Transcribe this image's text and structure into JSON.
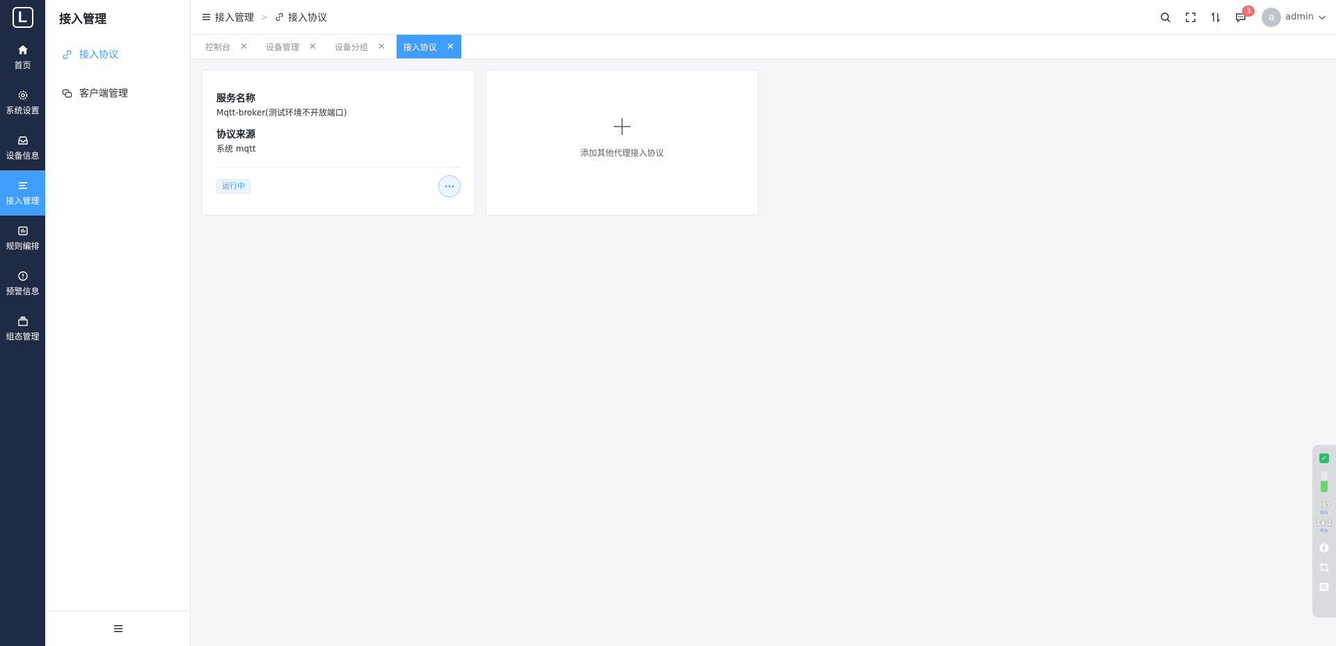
{
  "rail": {
    "logo": "L",
    "items": [
      {
        "label": "首页",
        "icon": "home-icon"
      },
      {
        "label": "系统设置",
        "icon": "gear-icon"
      },
      {
        "label": "设备信息",
        "icon": "inbox-icon"
      },
      {
        "label": "接入管理",
        "icon": "list-icon"
      },
      {
        "label": "规则编排",
        "icon": "chart-box-icon"
      },
      {
        "label": "预警信息",
        "icon": "alert-circle-icon"
      },
      {
        "label": "组态管理",
        "icon": "layers-icon"
      }
    ],
    "active_index": 3
  },
  "sidebar": {
    "title": "接入管理",
    "items": [
      {
        "label": "接入协议",
        "icon": "link-icon"
      },
      {
        "label": "客户端管理",
        "icon": "chat-icon"
      }
    ],
    "active_index": 0
  },
  "header": {
    "breadcrumb": [
      "接入管理",
      "接入协议"
    ],
    "badge_count": "3",
    "user_avatar": "a",
    "user_name": "admin"
  },
  "tabs": [
    {
      "label": "控制台"
    },
    {
      "label": "设备管理"
    },
    {
      "label": "设备分组"
    },
    {
      "label": "接入协议"
    }
  ],
  "active_tab": 3,
  "card": {
    "service_label": "服务名称",
    "service_value": "Mqtt-broker(测试环境不开放端口)",
    "source_label": "协议来源",
    "source_value": "系统 mqtt",
    "status": "运行中"
  },
  "add_card": {
    "text": "添加其他代理接入协议"
  },
  "widget": {
    "download_speed": "867",
    "download_unit": "K/s",
    "upload_speed": "14.1",
    "upload_unit": "K/s"
  },
  "colors": {
    "rail_bg": "#1f2a44",
    "accent": "#409eff",
    "badge": "#f56c6c"
  }
}
